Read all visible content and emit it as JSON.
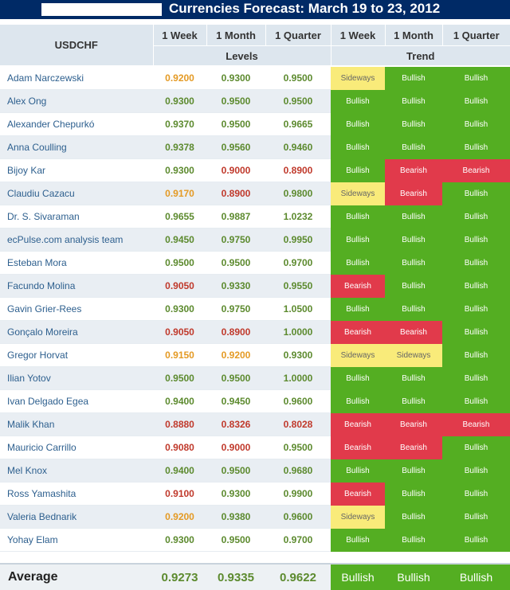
{
  "header": {
    "title": "Currencies Forecast: March 19 to 23, 2012",
    "pair": "USDCHF",
    "periods": [
      "1 Week",
      "1 Month",
      "1 Quarter",
      "1 Week",
      "1 Month",
      "1 Quarter"
    ],
    "levels_label": "Levels",
    "trend_label": "Trend"
  },
  "colors": {
    "banner": "#002a66",
    "bullish": "#54ae22",
    "bearish": "#e13a4b",
    "sideways": "#f9eb7a",
    "level_green": "#5c8a2e",
    "level_orange": "#e49a24",
    "level_red": "#c0392b"
  },
  "rows": [
    {
      "name": "Adam Narczewski",
      "levels": [
        "0.9200",
        "0.9300",
        "0.9500"
      ],
      "level_colors": [
        "orange",
        "green",
        "green"
      ],
      "trends": [
        "Sideways",
        "Bullish",
        "Bullish"
      ]
    },
    {
      "name": "Alex Ong",
      "levels": [
        "0.9300",
        "0.9500",
        "0.9500"
      ],
      "level_colors": [
        "green",
        "green",
        "green"
      ],
      "trends": [
        "Bullish",
        "Bullish",
        "Bullish"
      ]
    },
    {
      "name": "Alexander Chepurkó",
      "levels": [
        "0.9370",
        "0.9500",
        "0.9665"
      ],
      "level_colors": [
        "green",
        "green",
        "green"
      ],
      "trends": [
        "Bullish",
        "Bullish",
        "Bullish"
      ]
    },
    {
      "name": "Anna Coulling",
      "levels": [
        "0.9378",
        "0.9560",
        "0.9460"
      ],
      "level_colors": [
        "green",
        "green",
        "green"
      ],
      "trends": [
        "Bullish",
        "Bullish",
        "Bullish"
      ]
    },
    {
      "name": "Bijoy Kar",
      "levels": [
        "0.9300",
        "0.9000",
        "0.8900"
      ],
      "level_colors": [
        "green",
        "red",
        "red"
      ],
      "trends": [
        "Bullish",
        "Bearish",
        "Bearish"
      ]
    },
    {
      "name": "Claudiu Cazacu",
      "levels": [
        "0.9170",
        "0.8900",
        "0.9800"
      ],
      "level_colors": [
        "orange",
        "red",
        "green"
      ],
      "trends": [
        "Sideways",
        "Bearish",
        "Bullish"
      ]
    },
    {
      "name": "Dr. S. Sivaraman",
      "levels": [
        "0.9655",
        "0.9887",
        "1.0232"
      ],
      "level_colors": [
        "green",
        "green",
        "green"
      ],
      "trends": [
        "Bullish",
        "Bullish",
        "Bullish"
      ]
    },
    {
      "name": "ecPulse.com analysis team",
      "levels": [
        "0.9450",
        "0.9750",
        "0.9950"
      ],
      "level_colors": [
        "green",
        "green",
        "green"
      ],
      "trends": [
        "Bullish",
        "Bullish",
        "Bullish"
      ]
    },
    {
      "name": "Esteban Mora",
      "levels": [
        "0.9500",
        "0.9500",
        "0.9700"
      ],
      "level_colors": [
        "green",
        "green",
        "green"
      ],
      "trends": [
        "Bullish",
        "Bullish",
        "Bullish"
      ]
    },
    {
      "name": "Facundo Molina",
      "levels": [
        "0.9050",
        "0.9330",
        "0.9550"
      ],
      "level_colors": [
        "red",
        "green",
        "green"
      ],
      "trends": [
        "Bearish",
        "Bullish",
        "Bullish"
      ]
    },
    {
      "name": "Gavin Grier-Rees",
      "levels": [
        "0.9300",
        "0.9750",
        "1.0500"
      ],
      "level_colors": [
        "green",
        "green",
        "green"
      ],
      "trends": [
        "Bullish",
        "Bullish",
        "Bullish"
      ]
    },
    {
      "name": "Gonçalo Moreira",
      "levels": [
        "0.9050",
        "0.8900",
        "1.0000"
      ],
      "level_colors": [
        "red",
        "red",
        "green"
      ],
      "trends": [
        "Bearish",
        "Bearish",
        "Bullish"
      ]
    },
    {
      "name": "Gregor Horvat",
      "levels": [
        "0.9150",
        "0.9200",
        "0.9300"
      ],
      "level_colors": [
        "orange",
        "orange",
        "green"
      ],
      "trends": [
        "Sideways",
        "Sideways",
        "Bullish"
      ]
    },
    {
      "name": "Ilian Yotov",
      "levels": [
        "0.9500",
        "0.9500",
        "1.0000"
      ],
      "level_colors": [
        "green",
        "green",
        "green"
      ],
      "trends": [
        "Bullish",
        "Bullish",
        "Bullish"
      ]
    },
    {
      "name": "Ivan Delgado Egea",
      "levels": [
        "0.9400",
        "0.9450",
        "0.9600"
      ],
      "level_colors": [
        "green",
        "green",
        "green"
      ],
      "trends": [
        "Bullish",
        "Bullish",
        "Bullish"
      ]
    },
    {
      "name": "Malik Khan",
      "levels": [
        "0.8880",
        "0.8326",
        "0.8028"
      ],
      "level_colors": [
        "red",
        "red",
        "red"
      ],
      "trends": [
        "Bearish",
        "Bearish",
        "Bearish"
      ]
    },
    {
      "name": "Mauricio Carrillo",
      "levels": [
        "0.9080",
        "0.9000",
        "0.9500"
      ],
      "level_colors": [
        "red",
        "red",
        "green"
      ],
      "trends": [
        "Bearish",
        "Bearish",
        "Bullish"
      ]
    },
    {
      "name": "Mel Knox",
      "levels": [
        "0.9400",
        "0.9500",
        "0.9680"
      ],
      "level_colors": [
        "green",
        "green",
        "green"
      ],
      "trends": [
        "Bullish",
        "Bullish",
        "Bullish"
      ]
    },
    {
      "name": "Ross Yamashita",
      "levels": [
        "0.9100",
        "0.9300",
        "0.9900"
      ],
      "level_colors": [
        "red",
        "green",
        "green"
      ],
      "trends": [
        "Bearish",
        "Bullish",
        "Bullish"
      ]
    },
    {
      "name": "Valeria Bednarik",
      "levels": [
        "0.9200",
        "0.9380",
        "0.9600"
      ],
      "level_colors": [
        "orange",
        "green",
        "green"
      ],
      "trends": [
        "Sideways",
        "Bullish",
        "Bullish"
      ]
    },
    {
      "name": "Yohay Elam",
      "levels": [
        "0.9300",
        "0.9500",
        "0.9700"
      ],
      "level_colors": [
        "green",
        "green",
        "green"
      ],
      "trends": [
        "Bullish",
        "Bullish",
        "Bullish"
      ]
    }
  ],
  "average": {
    "label": "Average",
    "levels": [
      "0.9273",
      "0.9335",
      "0.9622"
    ],
    "trends": [
      "Bullish",
      "Bullish",
      "Bullish"
    ]
  }
}
